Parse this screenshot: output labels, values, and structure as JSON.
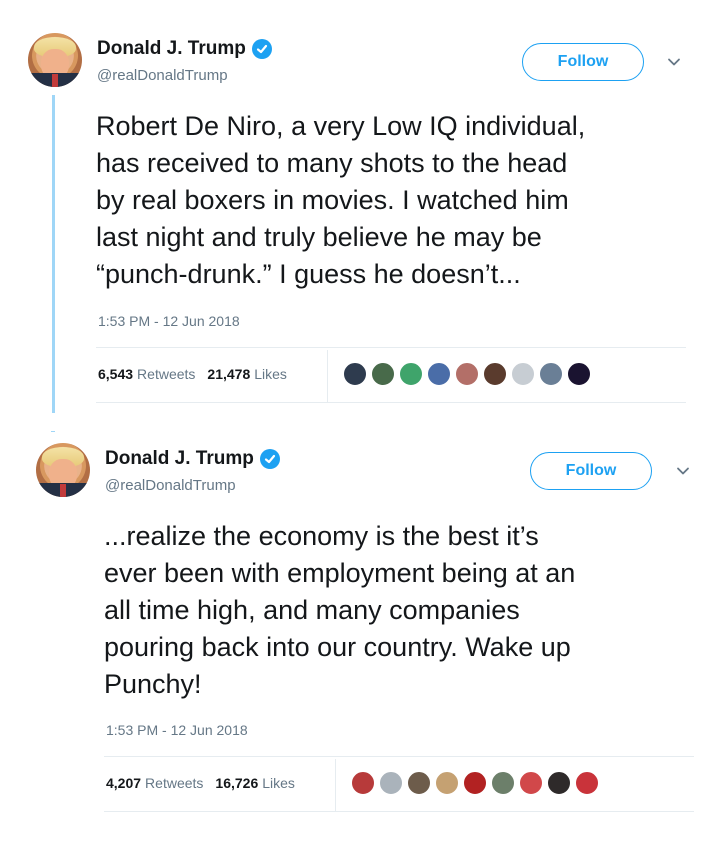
{
  "tweets": [
    {
      "name": "Donald J. Trump",
      "handle": "@realDonaldTrump",
      "follow_label": "Follow",
      "text": "Robert De Niro, a very Low IQ individual,\nhas received to many shots to the head\nby real boxers in movies. I watched him\nlast night and truly believe he may be\n“punch-drunk.” I guess he doesn’t...",
      "timestamp": "1:53 PM - 12 Jun 2018",
      "retweets_count": "6,543",
      "retweets_label": "Retweets",
      "likes_count": "21,478",
      "likes_label": "Likes",
      "facepile_colors": [
        "#2e3b4e",
        "#486a4a",
        "#3fa46b",
        "#4a6da8",
        "#b36f68",
        "#5a3b2d",
        "#c7cdd3",
        "#6a7f96",
        "#1a1330"
      ]
    },
    {
      "name": "Donald J. Trump",
      "handle": "@realDonaldTrump",
      "follow_label": "Follow",
      "text": "...realize the economy is the best it’s\never been with employment being at an\nall time high, and many companies\npouring back into our country. Wake up\nPunchy!",
      "timestamp": "1:53 PM - 12 Jun 2018",
      "retweets_count": "4,207",
      "retweets_label": "Retweets",
      "likes_count": "16,726",
      "likes_label": "Likes",
      "facepile_colors": [
        "#b73a3a",
        "#aab3bb",
        "#6d5c4b",
        "#c5a172",
        "#b22222",
        "#6c7f6a",
        "#d1484a",
        "#2e2a2a",
        "#c9333a"
      ]
    }
  ],
  "colors": {
    "accent": "#1da1f2",
    "secondary_text": "#657786",
    "primary_text": "#14171a",
    "divider": "#e6ecf0",
    "thread_line": "#9fd6f7"
  },
  "icons": [
    "verified-badge-icon",
    "chevron-down-icon"
  ]
}
